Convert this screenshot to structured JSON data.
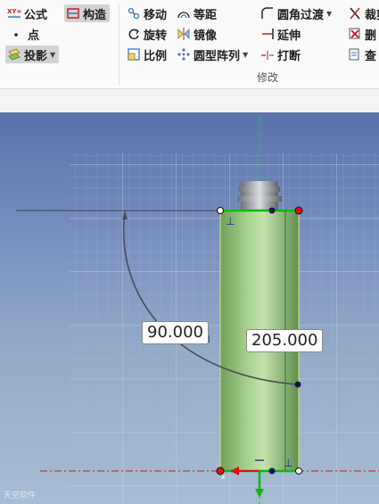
{
  "ribbon": {
    "group_left": {
      "formula_label": "公式",
      "point_label": "点",
      "construct_label": "构造",
      "project_label": "投影"
    },
    "modify": {
      "move_label": "移动",
      "offset_label": "等距",
      "rotate_label": "旋转",
      "mirror_label": "镜像",
      "scale_label": "比例",
      "circular_array_label": "圆型阵列",
      "fillet_label": "圆角过渡",
      "extend_label": "延伸",
      "break_label": "打断",
      "trim_label": "裁剪",
      "delete_label": "删",
      "check_label": "查",
      "group_title": "修改"
    }
  },
  "viewport": {
    "dimensions": {
      "angle": "90.000",
      "length": "205.000"
    },
    "watermark": "天空软件"
  },
  "colors": {
    "bg_top": "#5a72ab",
    "bg_bottom": "#a7bdd4",
    "grid": "#9fb6cf",
    "selection_green": "#0fb80f",
    "cylinder": "#8fbf78",
    "axis_red": "#cc1b1b",
    "point_red": "#e01010"
  }
}
